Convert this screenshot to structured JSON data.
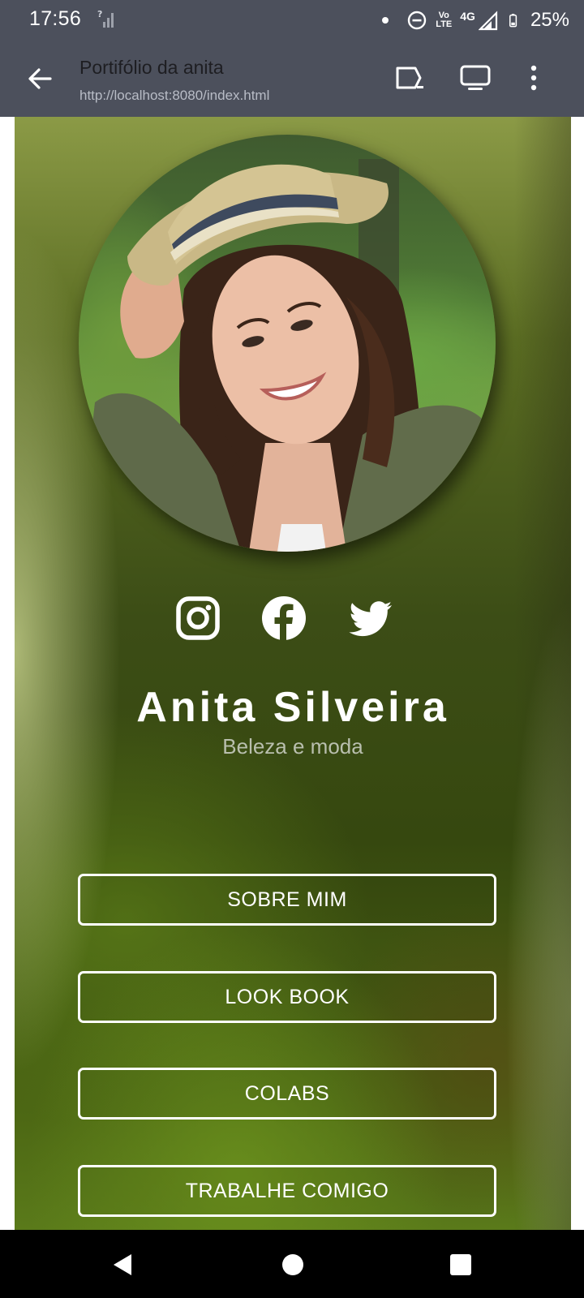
{
  "status_bar": {
    "time": "17:56",
    "volte_top": "Vo",
    "volte_bottom": "LTE",
    "network": "4G",
    "battery": "25%"
  },
  "toolbar": {
    "title": "Portifólio da anita",
    "url": "http://localhost:8080/index.html"
  },
  "profile": {
    "name": "Anita Silveira",
    "subtitle": "Beleza e moda"
  },
  "social": [
    "instagram-icon",
    "facebook-icon",
    "twitter-icon"
  ],
  "buttons": [
    {
      "label": "SOBRE MIM"
    },
    {
      "label": "LOOK BOOK"
    },
    {
      "label": "COLABS"
    },
    {
      "label": "TRABALHE COMIGO"
    }
  ],
  "colors": {
    "chrome_bar": "#4c505c",
    "card_green": "#3c4d16",
    "text": "#ffffff",
    "subtitle": "#b9bfae"
  }
}
